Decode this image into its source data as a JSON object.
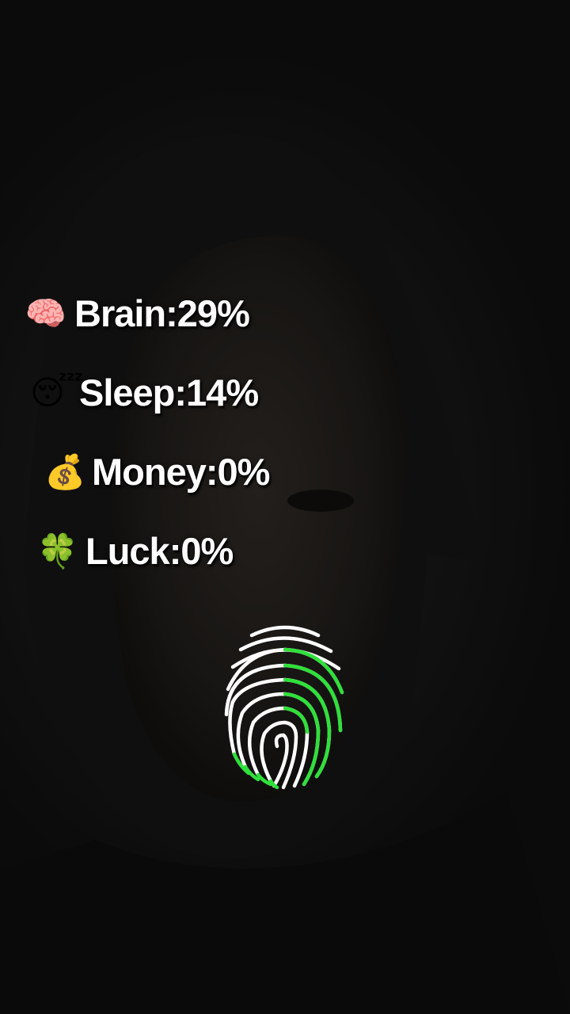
{
  "stats": [
    {
      "icon": "brain-icon",
      "emoji": "🧠",
      "label": "Brain:29%"
    },
    {
      "icon": "sleeping-face-icon",
      "emoji": "😴",
      "label": "Sleep:14%"
    },
    {
      "icon": "money-bag-icon",
      "emoji": "💰",
      "label": "Money:0%"
    },
    {
      "icon": "four-leaf-clover-icon",
      "emoji": "🍀",
      "label": "Luck:0%"
    }
  ],
  "fingerprint": {
    "icon": "fingerprint-icon",
    "base_color": "#ffffff",
    "scan_color": "#2fe03a"
  }
}
